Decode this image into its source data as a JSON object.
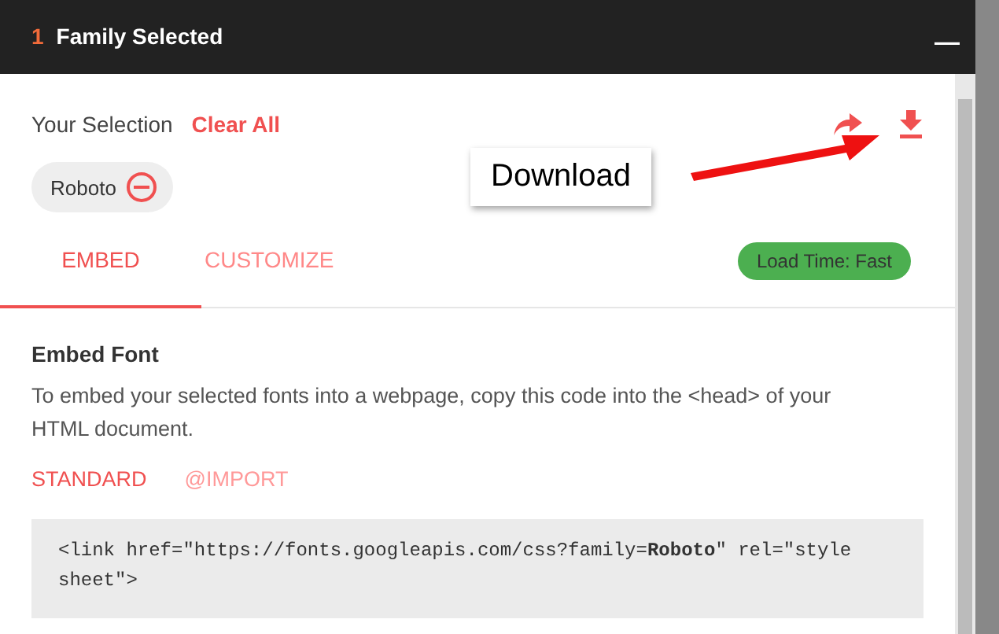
{
  "header": {
    "count": "1",
    "title": "Family Selected",
    "minimize": "—"
  },
  "selection": {
    "label": "Your Selection",
    "clear": "Clear All",
    "chips": [
      {
        "name": "Roboto"
      }
    ]
  },
  "callout": {
    "text": "Download"
  },
  "tabs": [
    {
      "label": "EMBED",
      "selected": true
    },
    {
      "label": "CUSTOMIZE",
      "selected": false
    }
  ],
  "badge": "Load Time: Fast",
  "embed": {
    "title": "Embed Font",
    "description": "To embed your selected fonts into a webpage, copy this code into the <head> of your HTML document.",
    "modes": [
      {
        "label": "STANDARD",
        "selected": true
      },
      {
        "label": "@IMPORT",
        "selected": false
      }
    ],
    "code": "<link href=\"https://fonts.googleapis.com/css?family=**Roboto**\" rel=\"stylesheet\">"
  }
}
